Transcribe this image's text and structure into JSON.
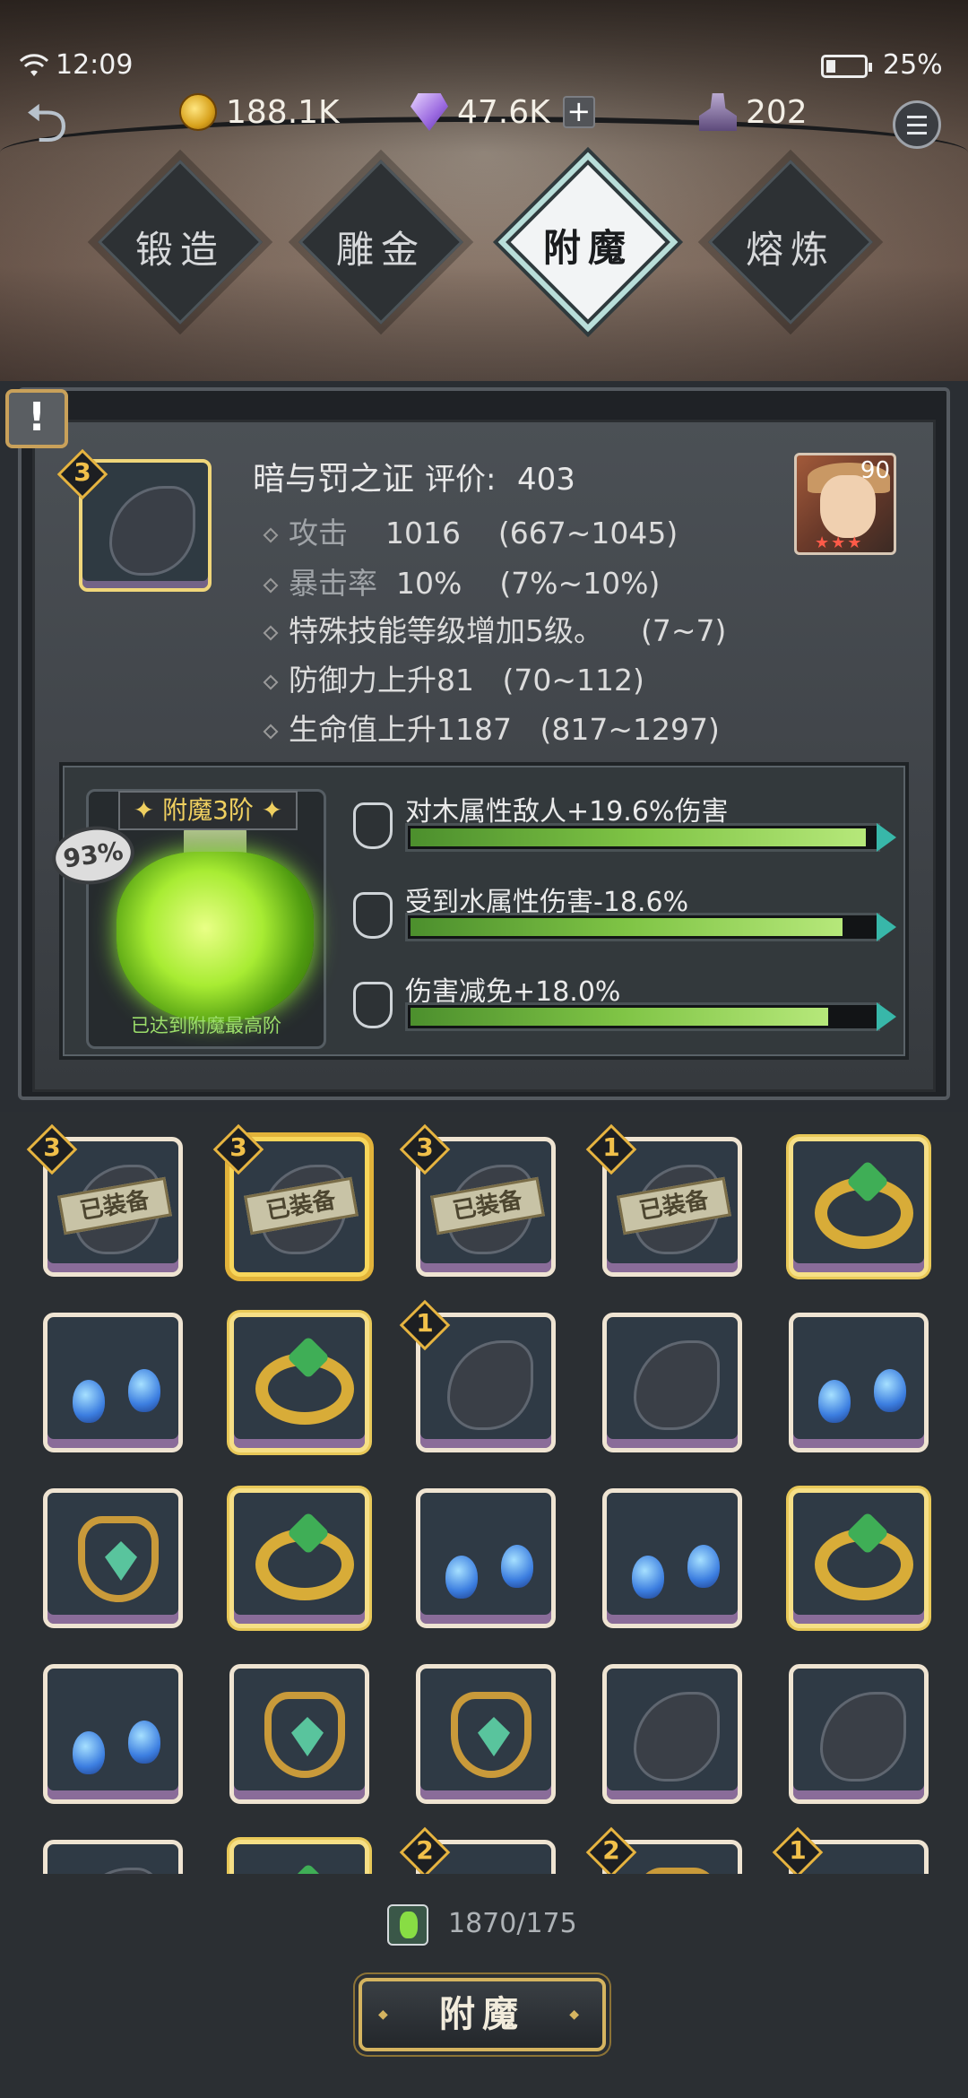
{
  "status_bar": {
    "time": "12:09",
    "battery": "25%"
  },
  "resources": {
    "gold": "188.1K",
    "diamonds": "47.6K",
    "ink": "202",
    "gold_icon": "coin-icon",
    "diamond_icon": "diamond-icon",
    "ink_icon": "ink-bottle-icon"
  },
  "tabs": [
    {
      "label": "锻造",
      "active": false
    },
    {
      "label": "雕金",
      "active": false
    },
    {
      "label": "附魔",
      "active": true
    },
    {
      "label": "熔炼",
      "active": false
    }
  ],
  "item": {
    "level": "3",
    "name": "暗与罚之证",
    "score_label": "评价:",
    "score": "403",
    "hero_level": "90",
    "stats": [
      {
        "label": "攻击",
        "value": "1016",
        "range": "(667~1045)"
      },
      {
        "label": "暴击率",
        "value": "10%",
        "range": "(7%~10%)"
      },
      {
        "label": "特殊技能等级增加5级。",
        "value": "",
        "range": "(7~7)"
      },
      {
        "label": "防御力上升81",
        "value": "",
        "range": "(70~112)"
      },
      {
        "label": "生命值上升1187",
        "value": "",
        "range": "(817~1297)"
      }
    ]
  },
  "enchant": {
    "level_label": "附魔3阶",
    "percent": "93%",
    "max_text": "已达到附魔最高阶",
    "bonuses": [
      {
        "label": "对木属性敌人+19.6%伤害",
        "fill": 0.98
      },
      {
        "label": "受到水属性伤害-18.6%",
        "fill": 0.93
      },
      {
        "label": "伤害减免+18.0%",
        "fill": 0.9
      }
    ]
  },
  "inventory": {
    "equipped_label": "已装备",
    "rows": [
      [
        {
          "type": "claw",
          "lv": "3",
          "equipped": true
        },
        {
          "type": "claw",
          "lv": "3",
          "equipped": true,
          "selected": true
        },
        {
          "type": "claw",
          "lv": "3",
          "equipped": true
        },
        {
          "type": "claw",
          "lv": "1",
          "equipped": true
        },
        {
          "type": "ring",
          "lv": ""
        }
      ],
      [
        {
          "type": "earring",
          "lv": ""
        },
        {
          "type": "ring",
          "lv": ""
        },
        {
          "type": "claw",
          "lv": "1"
        },
        {
          "type": "claw",
          "lv": ""
        },
        {
          "type": "earring",
          "lv": ""
        }
      ],
      [
        {
          "type": "necklace",
          "lv": ""
        },
        {
          "type": "ring",
          "lv": ""
        },
        {
          "type": "earring",
          "lv": ""
        },
        {
          "type": "earring",
          "lv": ""
        },
        {
          "type": "ring2",
          "lv": ""
        }
      ],
      [
        {
          "type": "earring",
          "lv": ""
        },
        {
          "type": "necklace",
          "lv": ""
        },
        {
          "type": "necklace2",
          "lv": ""
        },
        {
          "type": "claw",
          "lv": ""
        },
        {
          "type": "claw",
          "lv": ""
        }
      ],
      [
        {
          "type": "claw",
          "lv": ""
        },
        {
          "type": "ring2",
          "lv": ""
        },
        {
          "type": "earring",
          "lv": "2"
        },
        {
          "type": "necklace2",
          "lv": "2"
        },
        {
          "type": "gem",
          "lv": "1"
        }
      ]
    ]
  },
  "material": {
    "count": "1870/175"
  },
  "action_button": {
    "label": "附魔"
  }
}
